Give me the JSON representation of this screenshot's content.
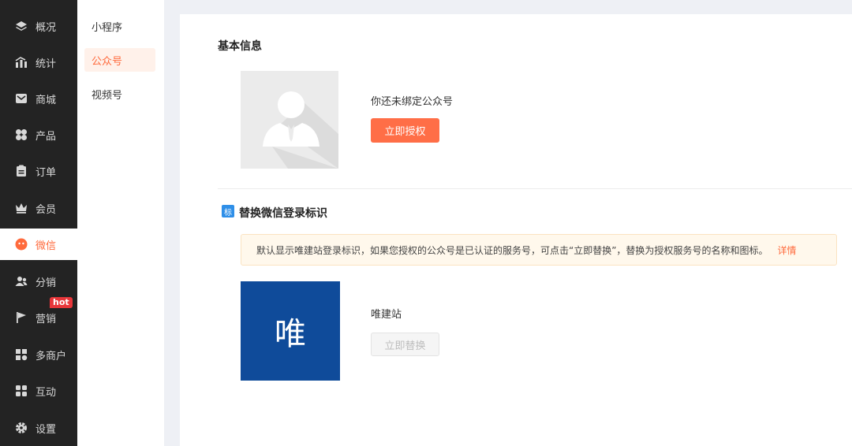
{
  "nav": {
    "items": [
      {
        "label": "概况",
        "icon": "layers-icon"
      },
      {
        "label": "统计",
        "icon": "stats-icon"
      },
      {
        "label": "商城",
        "icon": "store-icon"
      },
      {
        "label": "产品",
        "icon": "product-icon"
      },
      {
        "label": "订单",
        "icon": "order-icon"
      },
      {
        "label": "会员",
        "icon": "crown-icon"
      },
      {
        "label": "微信",
        "icon": "wechat-icon",
        "active": true
      },
      {
        "label": "分销",
        "icon": "distribution-icon"
      },
      {
        "label": "营销",
        "icon": "flag-icon"
      },
      {
        "label": "多商户",
        "icon": "merchant-icon"
      },
      {
        "label": "互动",
        "icon": "interact-icon"
      },
      {
        "label": "设置",
        "icon": "gear-icon"
      }
    ],
    "hot_badge": "hot"
  },
  "submenu": {
    "items": [
      {
        "label": "小程序"
      },
      {
        "label": "公众号",
        "active": true
      },
      {
        "label": "视频号"
      }
    ]
  },
  "basic_info": {
    "title": "基本信息",
    "bind_text": "你还未绑定公众号",
    "authorize_button": "立即授权"
  },
  "replace_logo": {
    "tag": "标",
    "title": "替换微信登录标识",
    "notice": "默认显示唯建站登录标识，如果您授权的公众号是已认证的服务号，可点击“立即替换”，替换为授权服务号的名称和图标。",
    "notice_link": "详情",
    "logo_char": "唯",
    "site_name": "唯建站",
    "replace_button": "立即替换"
  },
  "colors": {
    "accent": "#ff6a3c",
    "nav_bg": "#232323",
    "logo_bg": "#0f4b9a"
  }
}
